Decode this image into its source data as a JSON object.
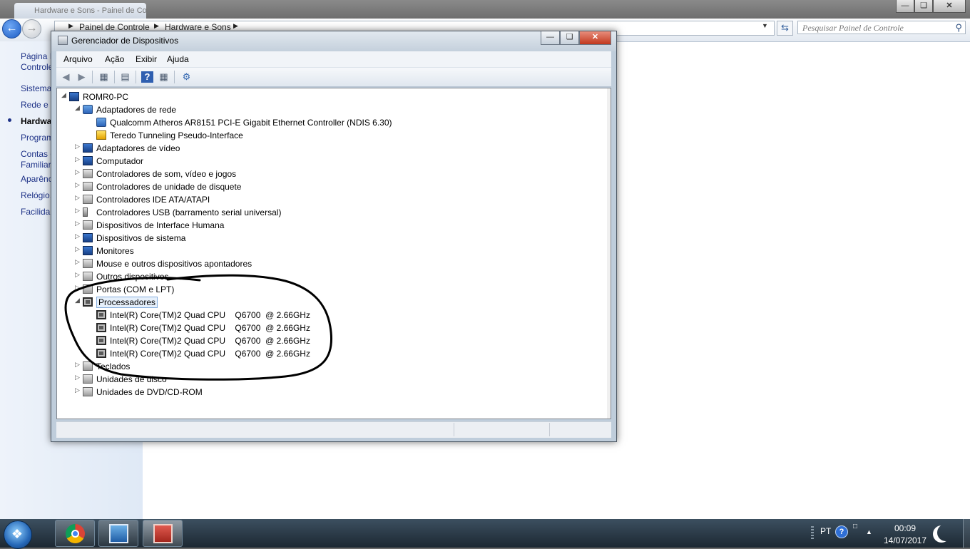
{
  "control_panel": {
    "tab_title": "Hardware e Sons - Painel de Controle",
    "breadcrumbs": [
      "Painel de Controle",
      "Hardware e Sons"
    ],
    "search_placeholder": "Pesquisar Painel de Controle",
    "sidebar": [
      {
        "label": "Página I"
      },
      {
        "label": "Controle"
      },
      {
        "label": "Sistema"
      },
      {
        "label": "Rede e I"
      },
      {
        "label": "Hardwa",
        "current": true
      },
      {
        "label": "Program"
      },
      {
        "label": "Contas d"
      },
      {
        "label": "Familiar"
      },
      {
        "label": "Aparênc"
      },
      {
        "label": "Relógio,"
      },
      {
        "label": "Facilida"
      }
    ]
  },
  "device_manager": {
    "title": "Gerenciador de Dispositivos",
    "menu": [
      "Arquivo",
      "Ação",
      "Exibir",
      "Ajuda"
    ],
    "toolbar_icons": [
      "back-icon",
      "forward-icon",
      "show-hide-tree-icon",
      "properties-icon",
      "help-icon",
      "update-driver-icon",
      "scan-hardware-icon"
    ],
    "tree": [
      {
        "label": "ROMR0-PC",
        "level": 0,
        "expander": "expanded",
        "icon": "computer-icon"
      },
      {
        "label": "Adaptadores de rede",
        "level": 1,
        "expander": "expanded",
        "icon": "network-adapter-icon"
      },
      {
        "label": "Qualcomm Atheros AR8151 PCI-E Gigabit Ethernet Controller (NDIS 6.30)",
        "level": 2,
        "expander": "none",
        "icon": "network-adapter-icon"
      },
      {
        "label": "Teredo Tunneling Pseudo-Interface",
        "level": 2,
        "expander": "none",
        "icon": "network-warning-icon"
      },
      {
        "label": "Adaptadores de vídeo",
        "level": 1,
        "expander": "collapsed",
        "icon": "display-adapter-icon"
      },
      {
        "label": "Computador",
        "level": 1,
        "expander": "collapsed",
        "icon": "computer-icon"
      },
      {
        "label": "Controladores de som, vídeo e jogos",
        "level": 1,
        "expander": "collapsed",
        "icon": "speaker-icon"
      },
      {
        "label": "Controladores de unidade de disquete",
        "level": 1,
        "expander": "collapsed",
        "icon": "floppy-controller-icon"
      },
      {
        "label": "Controladores IDE ATA/ATAPI",
        "level": 1,
        "expander": "collapsed",
        "icon": "ide-controller-icon"
      },
      {
        "label": "Controladores USB (barramento serial universal)",
        "level": 1,
        "expander": "collapsed",
        "icon": "usb-icon"
      },
      {
        "label": "Dispositivos de Interface Humana",
        "level": 1,
        "expander": "collapsed",
        "icon": "hid-icon"
      },
      {
        "label": "Dispositivos de sistema",
        "level": 1,
        "expander": "collapsed",
        "icon": "system-device-icon"
      },
      {
        "label": "Monitores",
        "level": 1,
        "expander": "collapsed",
        "icon": "monitor-icon"
      },
      {
        "label": "Mouse e outros dispositivos apontadores",
        "level": 1,
        "expander": "collapsed",
        "icon": "mouse-icon"
      },
      {
        "label": "Outros dispositivos",
        "level": 1,
        "expander": "collapsed",
        "icon": "other-device-icon"
      },
      {
        "label": "Portas (COM e LPT)",
        "level": 1,
        "expander": "collapsed",
        "icon": "port-icon"
      },
      {
        "label": "Processadores",
        "level": 1,
        "expander": "expanded",
        "icon": "processor-icon",
        "selected": true
      },
      {
        "label": "Intel(R) Core(TM)2 Quad CPU    Q6700  @ 2.66GHz",
        "level": 2,
        "expander": "none",
        "icon": "processor-icon"
      },
      {
        "label": "Intel(R) Core(TM)2 Quad CPU    Q6700  @ 2.66GHz",
        "level": 2,
        "expander": "none",
        "icon": "processor-icon"
      },
      {
        "label": "Intel(R) Core(TM)2 Quad CPU    Q6700  @ 2.66GHz",
        "level": 2,
        "expander": "none",
        "icon": "processor-icon"
      },
      {
        "label": "Intel(R) Core(TM)2 Quad CPU    Q6700  @ 2.66GHz",
        "level": 2,
        "expander": "none",
        "icon": "processor-icon"
      },
      {
        "label": "Teclados",
        "level": 1,
        "expander": "collapsed",
        "icon": "keyboard-icon"
      },
      {
        "label": "Unidades de disco",
        "level": 1,
        "expander": "collapsed",
        "icon": "disk-drive-icon"
      },
      {
        "label": "Unidades de DVD/CD-ROM",
        "level": 1,
        "expander": "collapsed",
        "icon": "dvd-drive-icon"
      }
    ]
  },
  "taskbar": {
    "buttons": [
      "chrome-icon",
      "control-panel-icon",
      "device-manager-icon"
    ],
    "language": "PT",
    "help_glyph": "?",
    "time": "00:09",
    "date": "14/07/2017"
  },
  "colors": {
    "selection_border": "#84acdd",
    "taskbar": "#1c2832",
    "annotation": "#000000"
  }
}
